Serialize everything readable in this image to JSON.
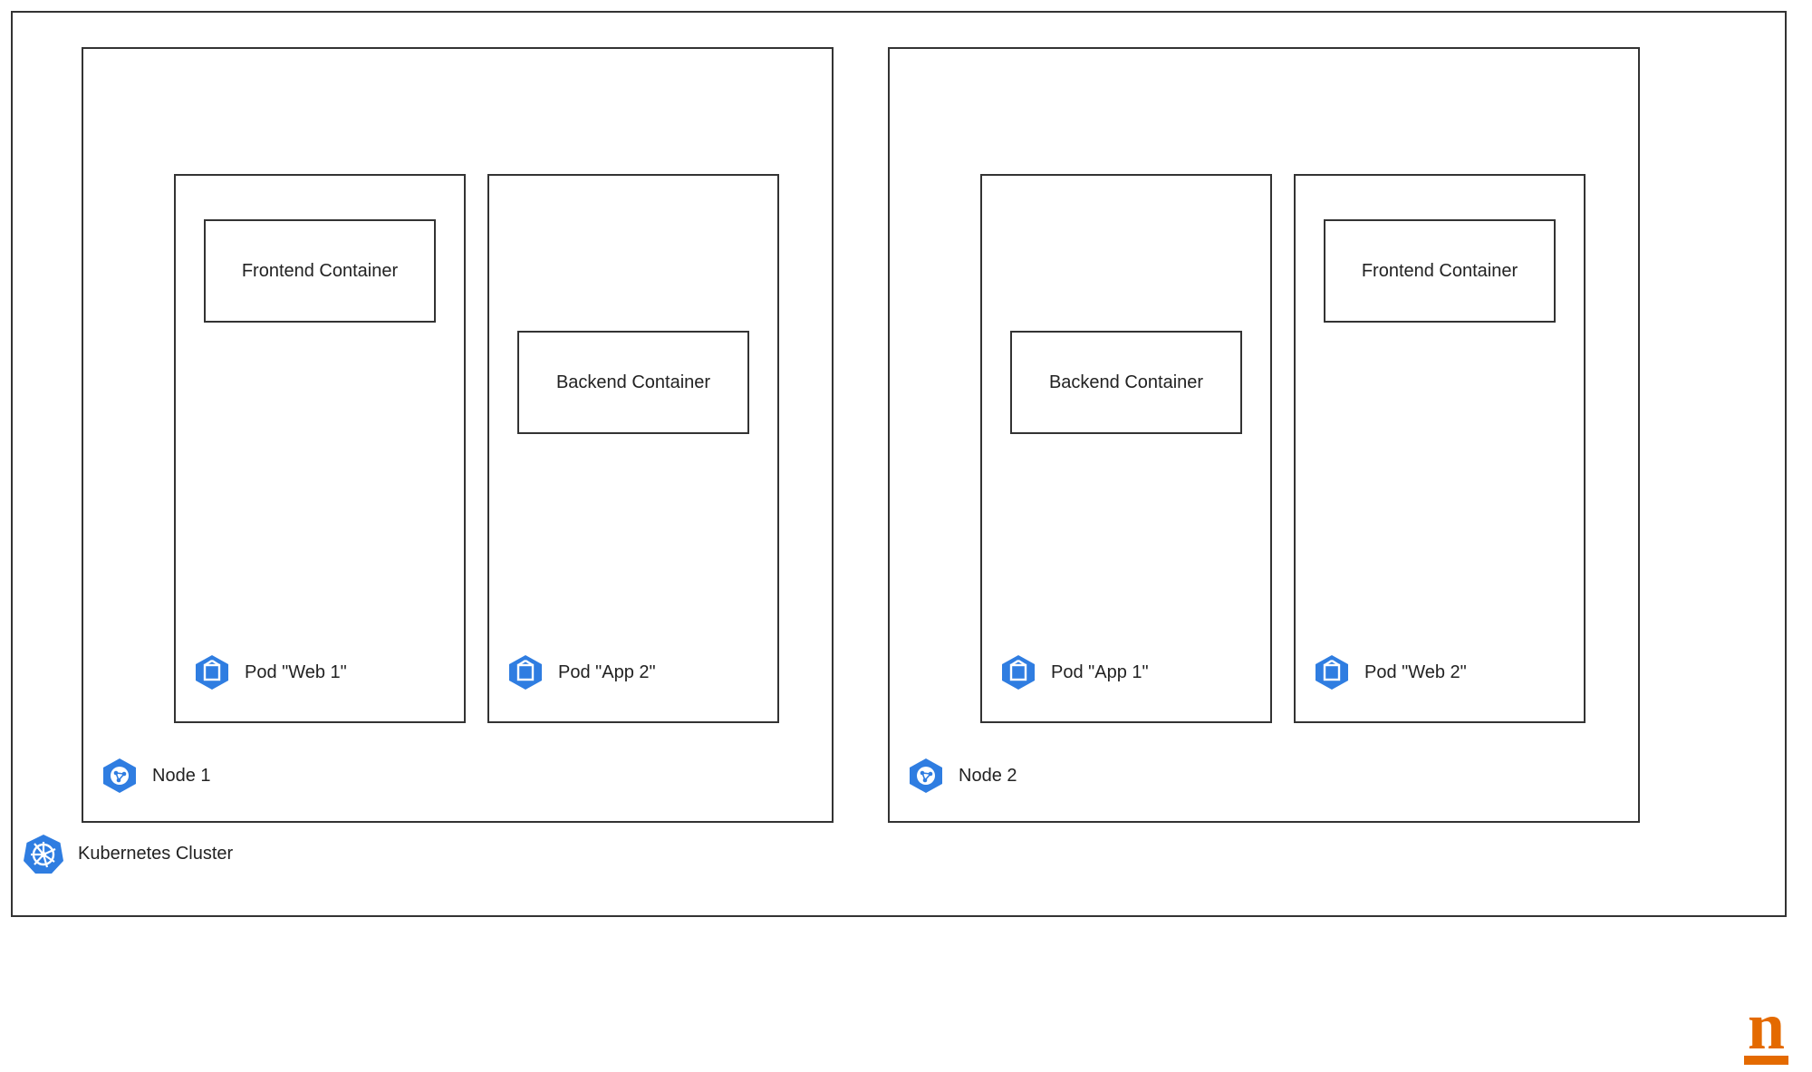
{
  "cluster": {
    "label": "Kubernetes Cluster",
    "nodes": [
      {
        "label": "Node 1",
        "pods": [
          {
            "label": "Pod \"Web 1\"",
            "container": "Frontend Container",
            "container_offset": "top"
          },
          {
            "label": "Pod \"App 2\"",
            "container": "Backend Container",
            "container_offset": "mid"
          }
        ]
      },
      {
        "label": "Node 2",
        "pods": [
          {
            "label": "Pod \"App 1\"",
            "container": "Backend Container",
            "container_offset": "mid"
          },
          {
            "label": "Pod \"Web 2\"",
            "container": "Frontend Container",
            "container_offset": "top"
          }
        ]
      }
    ]
  },
  "brand": "n",
  "colors": {
    "stroke": "#333333",
    "icon_blue": "#2f7de1",
    "brand_orange": "#e46a00"
  }
}
